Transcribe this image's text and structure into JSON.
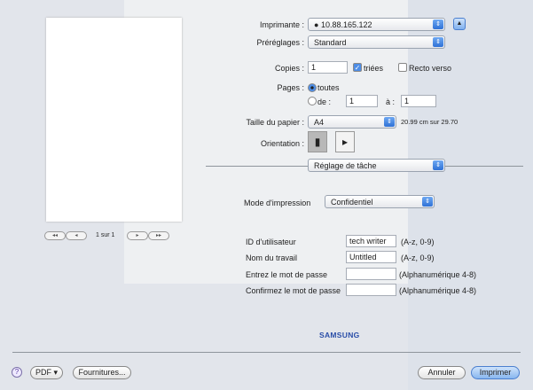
{
  "printer": {
    "label": "Imprimante :",
    "value": "10.88.165.122"
  },
  "presets": {
    "label": "Préréglages :",
    "value": "Standard"
  },
  "copies": {
    "label": "Copies :",
    "value": "1",
    "collated_label": "triées",
    "collated": true,
    "duplex_label": "Recto verso",
    "duplex": false
  },
  "pages": {
    "label": "Pages :",
    "all_label": "toutes",
    "from_label": "de :",
    "from": "1",
    "to_label": "à :",
    "to": "1"
  },
  "paper": {
    "label": "Taille du papier :",
    "value": "A4",
    "size_text": "20.99 cm sur 29.70"
  },
  "orientation": {
    "label": "Orientation :",
    "selected": "portrait"
  },
  "panel": {
    "value": "Réglage de tâche"
  },
  "mode": {
    "label": "Mode d'impression",
    "value": "Confidentiel"
  },
  "fields": [
    {
      "label": "ID d'utilisateur",
      "value": "tech writer",
      "hint": "(A-z, 0-9)"
    },
    {
      "label": "Nom du travail",
      "value": "Untitled",
      "hint": "(A-z, 0-9)"
    },
    {
      "label": "Entrez le mot de passe",
      "value": "",
      "hint": "(Alphanumérique 4-8)"
    },
    {
      "label": "Confirmez le mot de passe",
      "value": "",
      "hint": "(Alphanumérique 4-8)"
    }
  ],
  "preview": {
    "page_text": "1 sur 1",
    "first": "◂◂",
    "prev": "◂",
    "next": "▸",
    "last": "▸▸"
  },
  "brand": "SAMSUNG",
  "buttons": {
    "help": "?",
    "pdf": "PDF ▾",
    "supplies": "Fournitures...",
    "cancel": "Annuler",
    "print": "Imprimer"
  }
}
